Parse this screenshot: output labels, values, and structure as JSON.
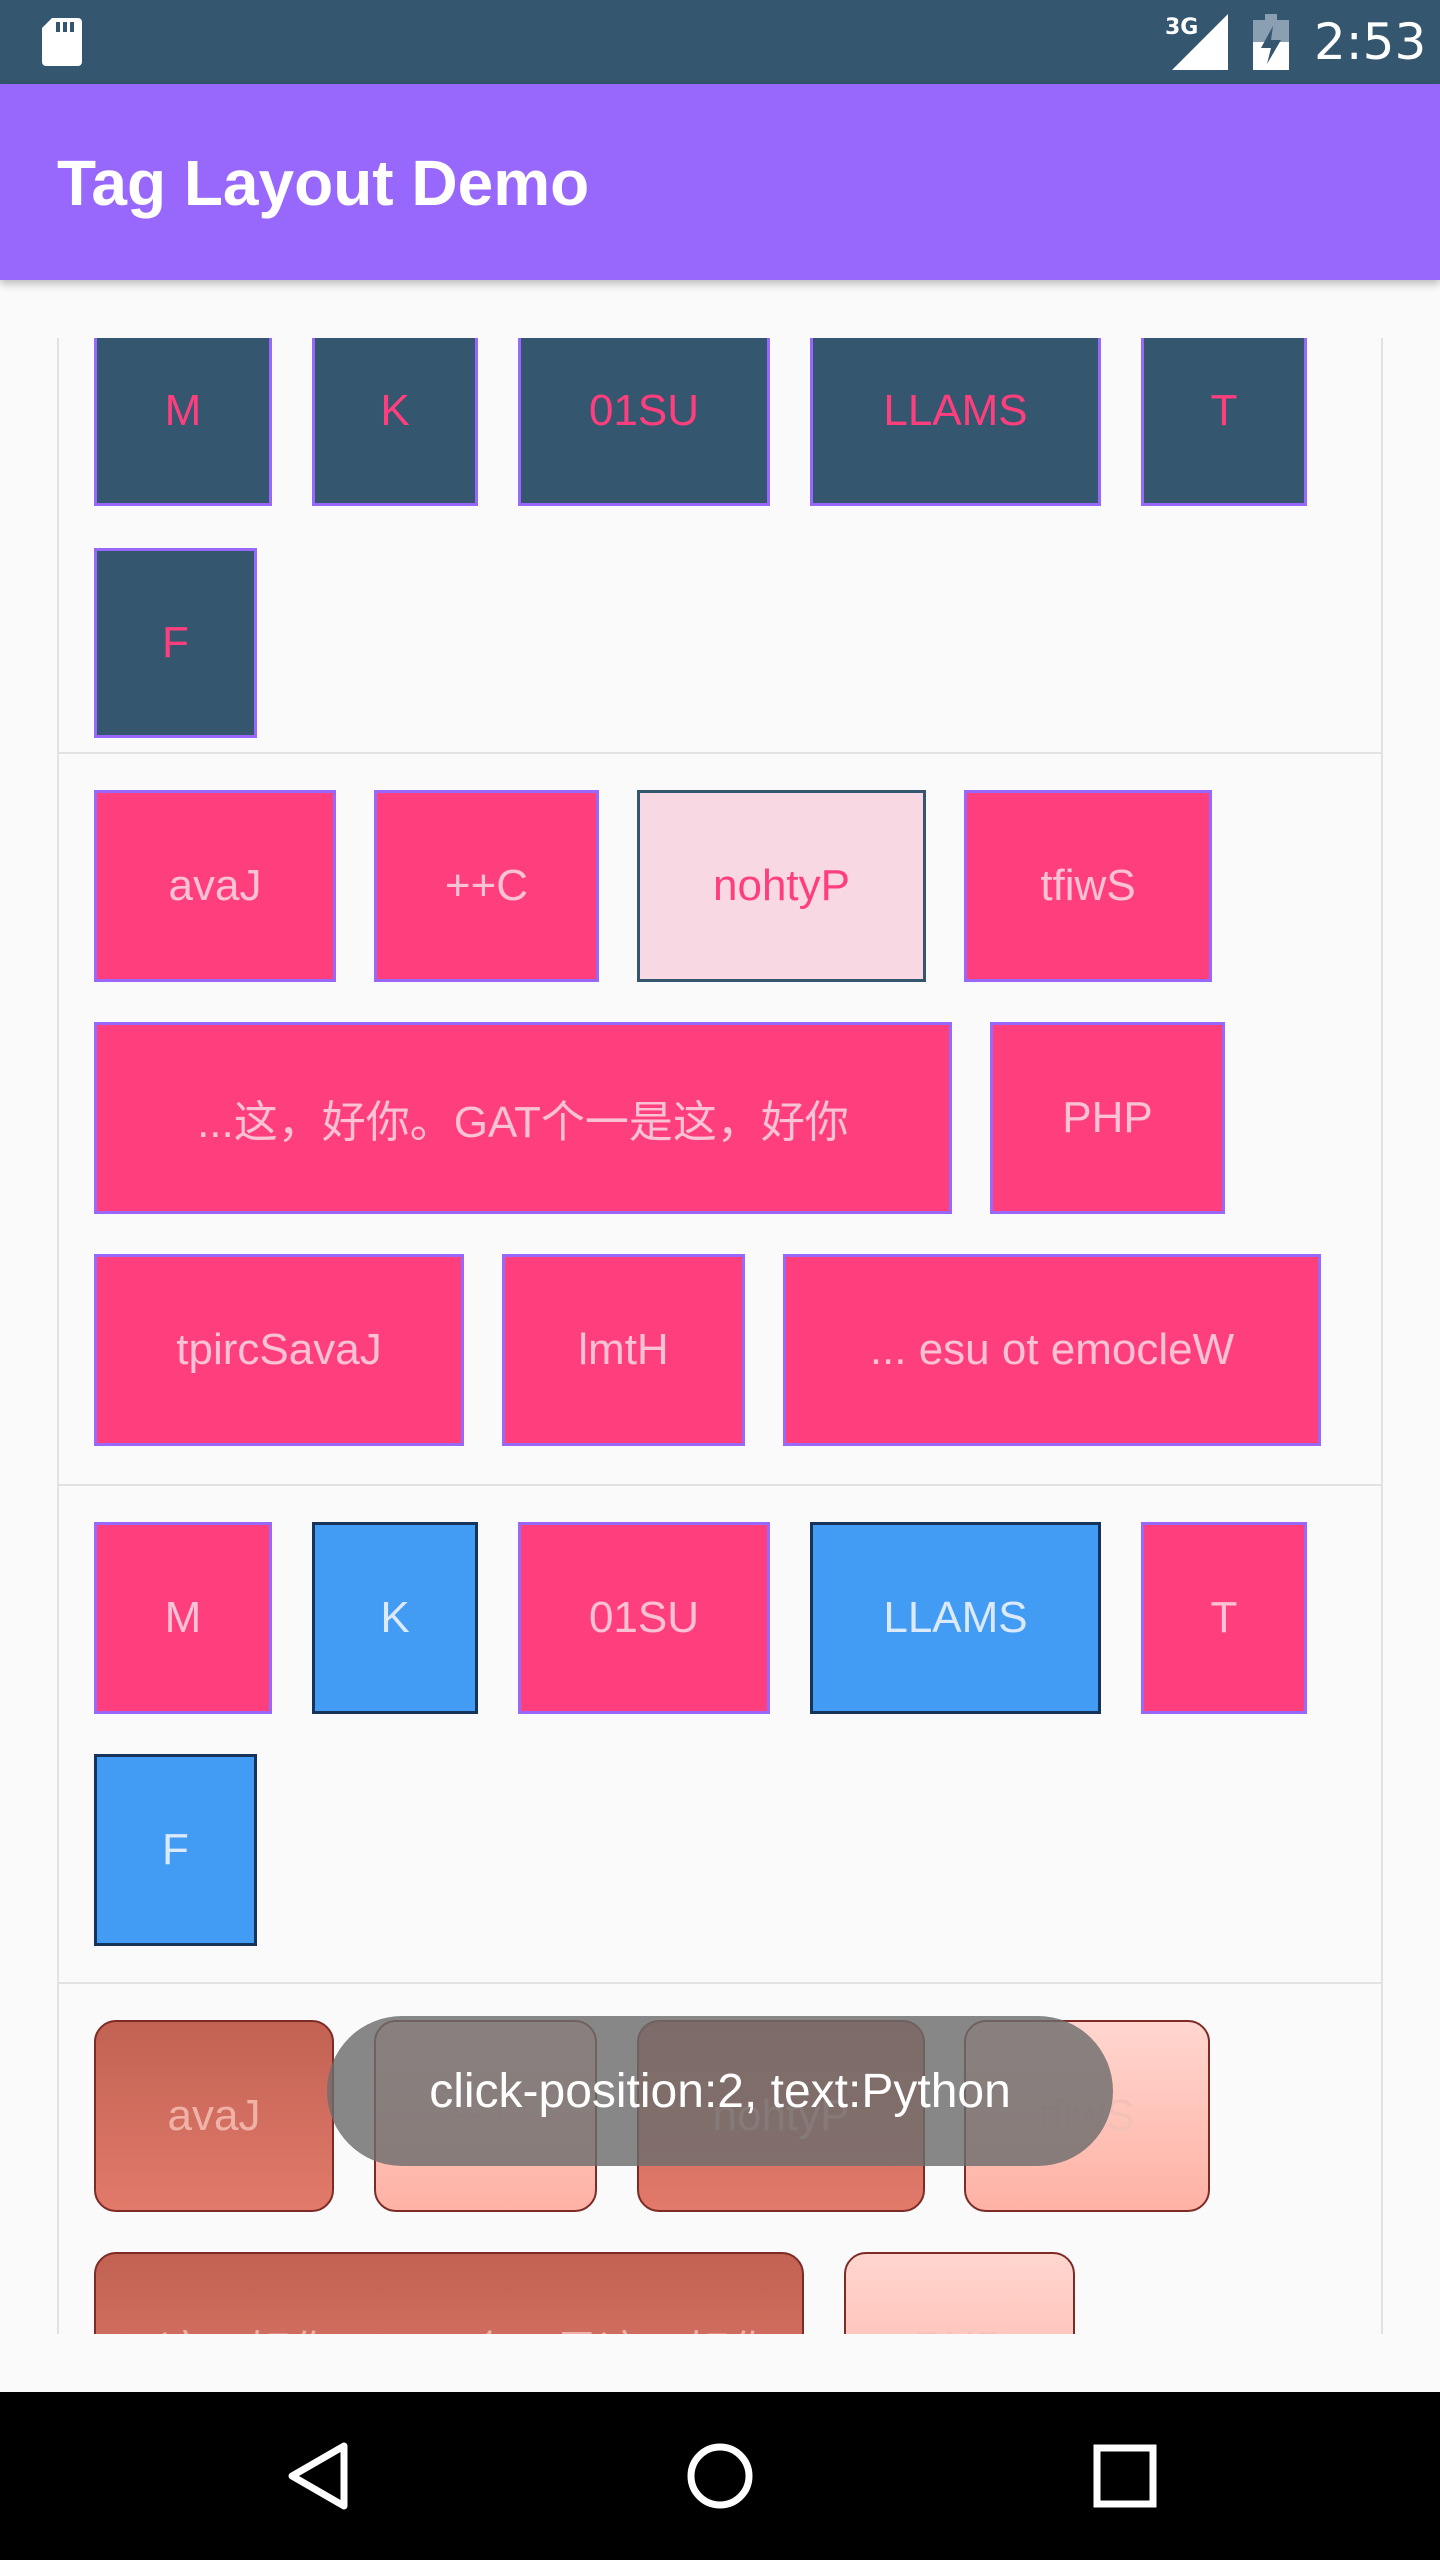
{
  "status_bar": {
    "network_type": "3G",
    "time": "2:53",
    "icons": [
      "sd-card-icon",
      "cellular-signal-icon",
      "battery-charging-icon"
    ]
  },
  "app_bar": {
    "title": "Tag Layout Demo"
  },
  "tag_blocks": [
    {
      "style": "dark-slate",
      "tags": [
        "M",
        "K",
        "01SU",
        "LLAMS",
        "T",
        "F"
      ]
    },
    {
      "style": "pink",
      "selected": "nohtyP",
      "tags": [
        "avaJ",
        "++C",
        "nohtyP",
        "tfiwS",
        "...这，好你。GAT个一是这，好你",
        "PHP",
        "tpircSavaJ",
        "lmtH",
        "... esu ot emocleW"
      ]
    },
    {
      "style": "pink-blue",
      "tags": [
        "M",
        "K",
        "01SU",
        "LLAMS",
        "T",
        "F"
      ]
    },
    {
      "style": "red-gradient",
      "tags": [
        "avaJ",
        "++C",
        "nohtyP",
        "tfiwS",
        "...这，好你。GAT个一是这，好你",
        "PHP"
      ]
    }
  ],
  "toast": {
    "text": "click-position:2, text:Python"
  },
  "nav_bar": {
    "icons": [
      "back-icon",
      "home-icon",
      "recents-icon"
    ]
  },
  "colors": {
    "status_bar": "#34566f",
    "app_bar": "#9868fc",
    "pink": "#ff3f7d",
    "blue": "#429cf3",
    "slate": "#34566f"
  }
}
